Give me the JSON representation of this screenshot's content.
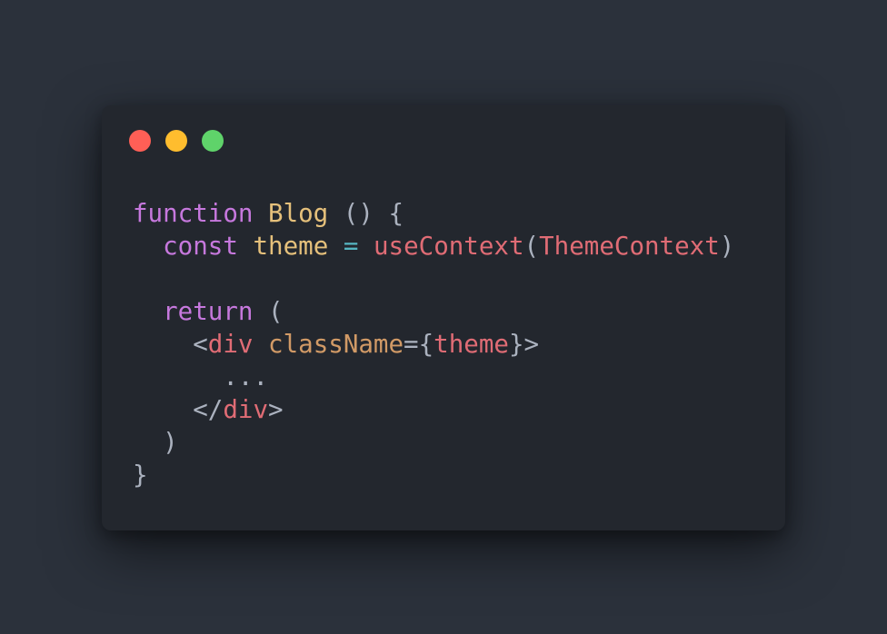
{
  "colors": {
    "background": "#2b313b",
    "window": "#23272e",
    "keyword": "#c678dd",
    "identifier": "#e5c07b",
    "function_call": "#e06c75",
    "operator": "#56b6c2",
    "tag": "#e06c75",
    "attribute": "#d19a66",
    "punctuation": "#abb2bf"
  },
  "window_controls": [
    {
      "name": "close-dot",
      "color": "#ff5f56"
    },
    {
      "name": "minimize-dot",
      "color": "#ffbd2e"
    },
    {
      "name": "maximize-dot",
      "color": "#5fd36a"
    }
  ],
  "code_lines": [
    [
      {
        "text": "function",
        "type": "keyword"
      },
      {
        "text": " ",
        "type": "punctuation"
      },
      {
        "text": "Blog",
        "type": "identifier"
      },
      {
        "text": " () {",
        "type": "punctuation"
      }
    ],
    [
      {
        "text": "  ",
        "type": "punctuation"
      },
      {
        "text": "const",
        "type": "keyword"
      },
      {
        "text": " ",
        "type": "punctuation"
      },
      {
        "text": "theme",
        "type": "identifier"
      },
      {
        "text": " ",
        "type": "punctuation"
      },
      {
        "text": "=",
        "type": "operator"
      },
      {
        "text": " ",
        "type": "punctuation"
      },
      {
        "text": "useContext",
        "type": "function_call"
      },
      {
        "text": "(",
        "type": "punctuation"
      },
      {
        "text": "ThemeContext",
        "type": "function_call"
      },
      {
        "text": ")",
        "type": "punctuation"
      }
    ],
    [],
    [
      {
        "text": "  ",
        "type": "punctuation"
      },
      {
        "text": "return",
        "type": "keyword"
      },
      {
        "text": " (",
        "type": "punctuation"
      }
    ],
    [
      {
        "text": "    <",
        "type": "punctuation"
      },
      {
        "text": "div",
        "type": "tag"
      },
      {
        "text": " ",
        "type": "punctuation"
      },
      {
        "text": "className",
        "type": "attribute"
      },
      {
        "text": "={",
        "type": "punctuation"
      },
      {
        "text": "theme",
        "type": "tag"
      },
      {
        "text": "}>",
        "type": "punctuation"
      }
    ],
    [
      {
        "text": "      ...",
        "type": "punctuation"
      }
    ],
    [
      {
        "text": "    </",
        "type": "punctuation"
      },
      {
        "text": "div",
        "type": "tag"
      },
      {
        "text": ">",
        "type": "punctuation"
      }
    ],
    [
      {
        "text": "  )",
        "type": "punctuation"
      }
    ],
    [
      {
        "text": "}",
        "type": "punctuation"
      }
    ]
  ]
}
